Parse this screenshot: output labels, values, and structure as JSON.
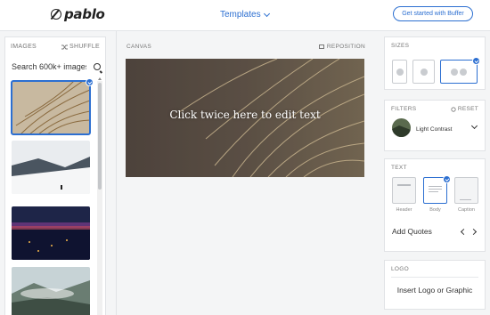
{
  "header": {
    "logo_text": "pablo",
    "templates_label": "Templates",
    "cta_label": "Get started with Buffer"
  },
  "images_panel": {
    "title": "IMAGES",
    "shuffle_label": "SHUFFLE",
    "search_value": "Search 600k+ images"
  },
  "canvas": {
    "title": "CANVAS",
    "reposition_label": "REPOSITION",
    "overlay_text": "Click twice here to edit text"
  },
  "sizes": {
    "title": "SIZES",
    "selected": "social"
  },
  "filters": {
    "title": "FILTERS",
    "reset_label": "RESET",
    "selected_filter": "Light Contrast"
  },
  "text": {
    "title": "TEXT",
    "options": [
      "Header",
      "Body",
      "Caption"
    ],
    "selected": "Body",
    "add_quotes": "Add Quotes"
  },
  "logo": {
    "title": "LOGO",
    "insert_label": "Insert Logo or Graphic"
  },
  "colors": {
    "accent": "#2c6fd1"
  }
}
